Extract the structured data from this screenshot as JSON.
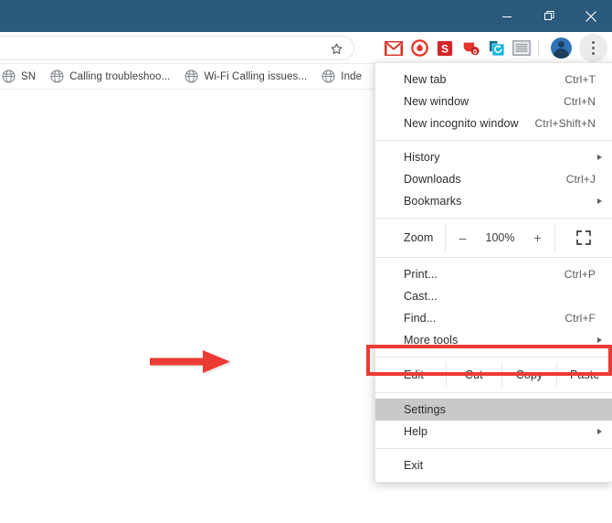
{
  "window": {
    "titlebar_color": "#2b5a7c",
    "controls": [
      {
        "name": "minimize",
        "glyph": "minimize-icon"
      },
      {
        "name": "restore",
        "glyph": "restore-icon"
      },
      {
        "name": "close",
        "glyph": "close-icon"
      }
    ]
  },
  "toolbar": {
    "omnibox": {
      "value": "",
      "placeholder": ""
    },
    "star_icon": "bookmark-star-icon",
    "extensions": [
      {
        "name": "gmail",
        "label": "M",
        "color": "#d93025"
      },
      {
        "name": "adblock",
        "label": "",
        "color": "#e8332a"
      },
      {
        "name": "grammarly",
        "label": "S",
        "color": "#d4262c"
      },
      {
        "name": "blocker",
        "label": "",
        "color": "#e8332a"
      },
      {
        "name": "sync",
        "label": "",
        "color": "#17b7e0"
      },
      {
        "name": "reader",
        "label": "",
        "color": "#9aa0a6"
      }
    ],
    "avatar": "profile-avatar",
    "menu_button": "three-dot-menu-icon"
  },
  "bookmarks_bar": {
    "items": [
      {
        "label": "SN",
        "icon": "globe-icon"
      },
      {
        "label": "Calling troubleshoo...",
        "icon": "globe-icon"
      },
      {
        "label": "Wi-Fi Calling issues...",
        "icon": "globe-icon"
      },
      {
        "label": "Inde",
        "icon": "globe-icon"
      }
    ]
  },
  "chrome_menu": {
    "group1": [
      {
        "label": "New tab",
        "accel": "Ctrl+T",
        "submenu": false
      },
      {
        "label": "New window",
        "accel": "Ctrl+N",
        "submenu": false
      },
      {
        "label": "New incognito window",
        "accel": "Ctrl+Shift+N",
        "submenu": false
      }
    ],
    "group2": [
      {
        "label": "History",
        "accel": "",
        "submenu": true
      },
      {
        "label": "Downloads",
        "accel": "Ctrl+J",
        "submenu": false
      },
      {
        "label": "Bookmarks",
        "accel": "",
        "submenu": true
      }
    ],
    "zoom": {
      "label": "Zoom",
      "minus": "–",
      "level": "100%",
      "plus": "+",
      "fullscreen_icon": "fullscreen-icon"
    },
    "group3": [
      {
        "label": "Print...",
        "accel": "Ctrl+P",
        "submenu": false
      },
      {
        "label": "Cast...",
        "accel": "",
        "submenu": false
      },
      {
        "label": "Find...",
        "accel": "Ctrl+F",
        "submenu": false
      },
      {
        "label": "More tools",
        "accel": "",
        "submenu": true
      }
    ],
    "edit_row": {
      "label": "Edit",
      "actions": [
        "Cut",
        "Copy",
        "Paste"
      ]
    },
    "group4": [
      {
        "label": "Settings",
        "accel": "",
        "submenu": false,
        "selected": true
      },
      {
        "label": "Help",
        "accel": "",
        "submenu": true,
        "selected": false
      }
    ],
    "group5": [
      {
        "label": "Exit",
        "accel": "",
        "submenu": false
      }
    ]
  },
  "annotation": {
    "highlight_color": "#ec3b34",
    "arrow_color": "#ec3b34",
    "target": "Settings"
  }
}
